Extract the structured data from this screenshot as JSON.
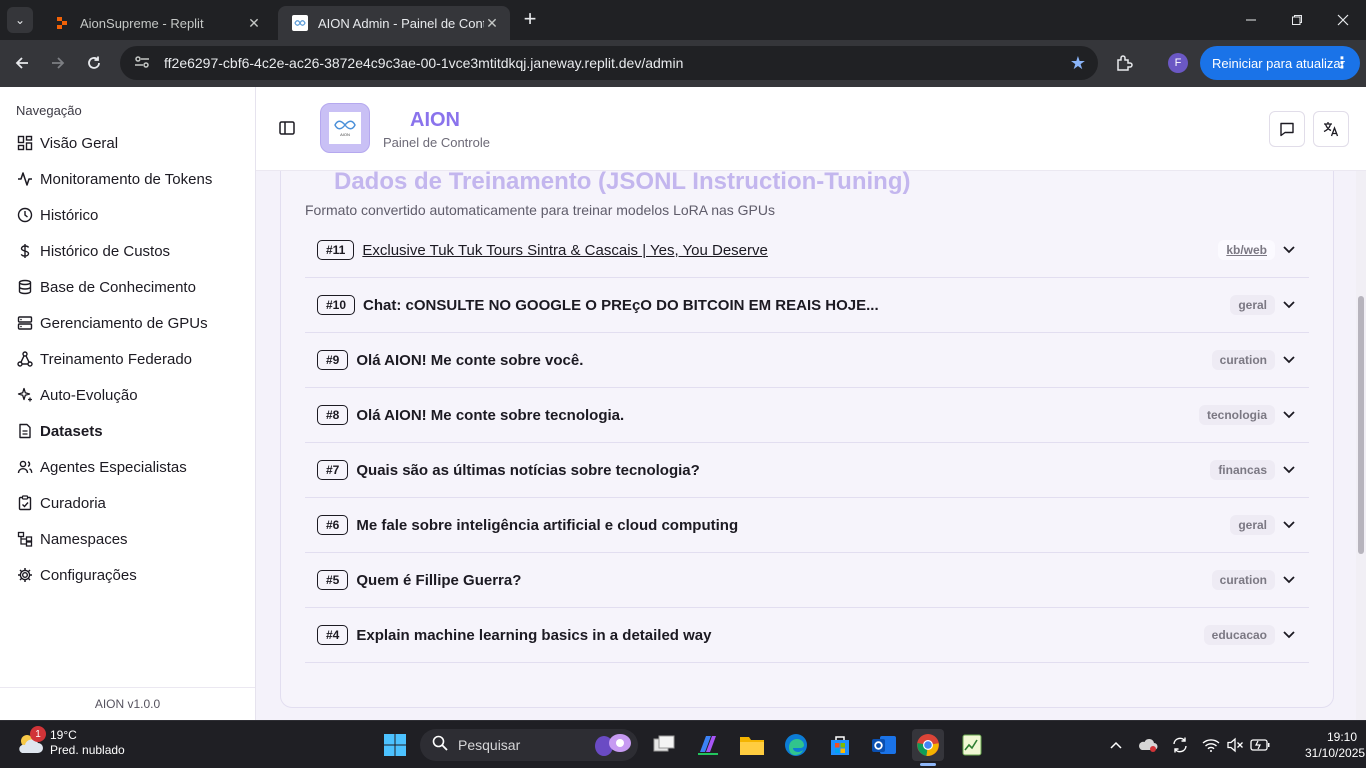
{
  "browser": {
    "tabs": [
      {
        "title": "AionSupreme - Replit",
        "active": false
      },
      {
        "title": "AION Admin - Painel de Controle",
        "active": true
      }
    ],
    "url": "ff2e6297-cbf6-4c2e-ac26-3872e4c9c3ae-00-1vce3mtitdkqj.janeway.replit.dev/admin",
    "profile_initial": "F",
    "update_label": "Reiniciar para atualizar"
  },
  "sidebar": {
    "group_label": "Navegação",
    "items": [
      {
        "label": "Visão Geral",
        "icon": "dashboard-icon"
      },
      {
        "label": "Monitoramento de Tokens",
        "icon": "activity-icon"
      },
      {
        "label": "Histórico",
        "icon": "clock-icon"
      },
      {
        "label": "Histórico de Custos",
        "icon": "dollar-icon"
      },
      {
        "label": "Base de Conhecimento",
        "icon": "database-icon"
      },
      {
        "label": "Gerenciamento de GPUs",
        "icon": "server-icon"
      },
      {
        "label": "Treinamento Federado",
        "icon": "network-icon"
      },
      {
        "label": "Auto-Evolução",
        "icon": "sparkles-icon"
      },
      {
        "label": "Datasets",
        "icon": "file-icon"
      },
      {
        "label": "Agentes Especialistas",
        "icon": "users-icon"
      },
      {
        "label": "Curadoria",
        "icon": "clipboard-check-icon"
      },
      {
        "label": "Namespaces",
        "icon": "sitemap-icon"
      },
      {
        "label": "Configurações",
        "icon": "gear-icon"
      }
    ],
    "footer": "AION v1.0.0"
  },
  "header": {
    "title": "AION",
    "subtitle": "Painel de Controle",
    "logo_text": "AION"
  },
  "section": {
    "title": "Dados de Treinamento (JSONL Instruction-Tuning)",
    "description": "Formato convertido automaticamente para treinar modelos LoRA nas GPUs",
    "rows": [
      {
        "num": "#11",
        "title": "Exclusive Tuk Tuk Tours Sintra & Cascais | Yes, You Deserve",
        "tag": "kb/web",
        "link": true
      },
      {
        "num": "#10",
        "title": "Chat: cONSULTE NO GOOGLE O PREçO DO BITCOIN EM REAIS HOJE...",
        "tag": "geral",
        "link": false
      },
      {
        "num": "#9",
        "title": "Olá AION! Me conte sobre você.",
        "tag": "curation",
        "link": false
      },
      {
        "num": "#8",
        "title": "Olá AION! Me conte sobre tecnologia.",
        "tag": "tecnologia",
        "link": false
      },
      {
        "num": "#7",
        "title": "Quais são as últimas notícias sobre tecnologia?",
        "tag": "financas",
        "link": false
      },
      {
        "num": "#6",
        "title": "Me fale sobre inteligência artificial e cloud computing",
        "tag": "geral",
        "link": false
      },
      {
        "num": "#5",
        "title": "Quem é Fillipe Guerra?",
        "tag": "curation",
        "link": false
      },
      {
        "num": "#4",
        "title": "Explain machine learning basics in a detailed way",
        "tag": "educacao",
        "link": false
      }
    ]
  },
  "taskbar": {
    "weather_temp": "19°C",
    "weather_desc": "Pred. nublado",
    "weather_badge": "1",
    "search_placeholder": "Pesquisar",
    "time": "19:10",
    "date": "31/10/2025"
  },
  "colors": {
    "accent": "#8a73ec",
    "title_faded": "#c3b6ee",
    "chrome_dark": "#202124",
    "update_blue": "#1a73e8"
  }
}
